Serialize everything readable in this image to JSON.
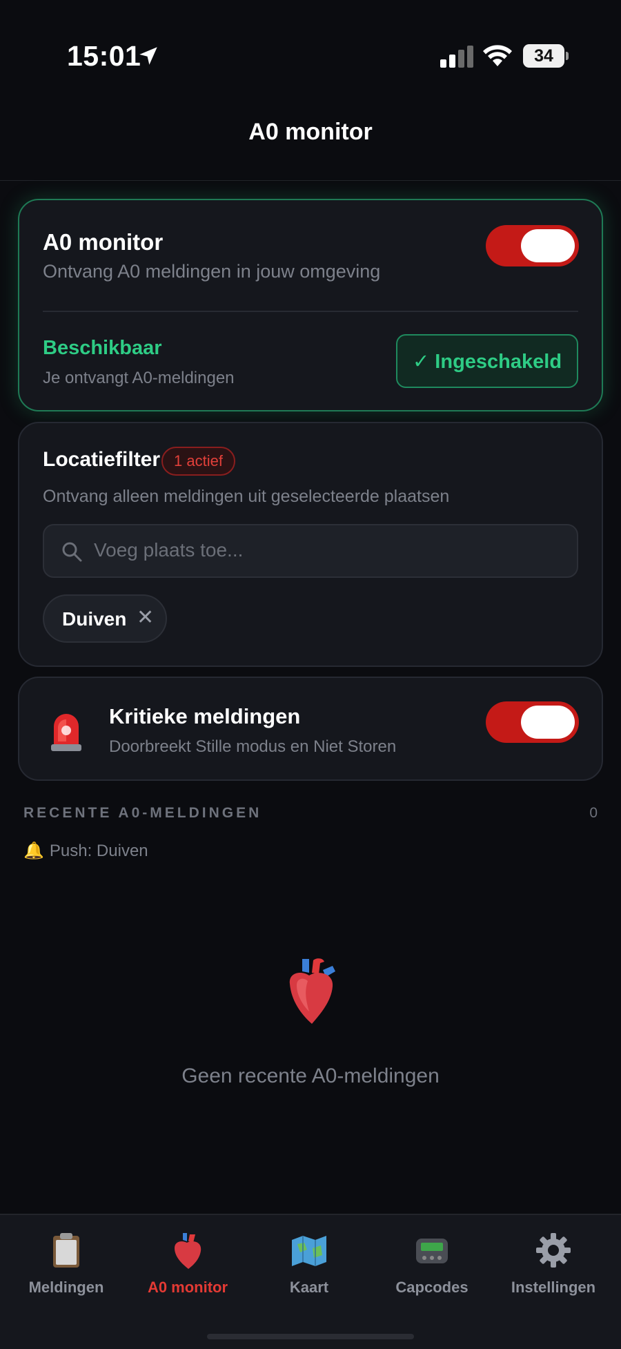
{
  "status_bar": {
    "time": "15:01",
    "battery": "34"
  },
  "header": {
    "title": "A0 monitor"
  },
  "monitor_card": {
    "title": "A0 monitor",
    "subtitle": "Ontvang A0 meldingen in jouw omgeving",
    "toggle_on": true,
    "availability_label": "Beschikbaar",
    "availability_sub": "Je ontvangt A0-meldingen",
    "enabled_button": "✓ Ingeschakeld"
  },
  "filter_card": {
    "title": "Locatiefilter",
    "badge": "1 actief",
    "subtitle": "Ontvang alleen meldingen uit geselecteerde plaatsen",
    "search_placeholder": "Voeg plaats toe...",
    "chips": [
      {
        "label": "Duiven",
        "remove": "✕"
      }
    ]
  },
  "critical_card": {
    "title": "Kritieke meldingen",
    "subtitle": "Doorbreekt Stille modus en Niet Storen",
    "toggle_on": true
  },
  "recent": {
    "section_title": "RECENTE A0-MELDINGEN",
    "count": "0",
    "push_info": "Push: Duiven",
    "empty_text": "Geen recente A0-meldingen"
  },
  "tabs": [
    {
      "label": "Meldingen",
      "icon": "clipboard-icon",
      "active": false
    },
    {
      "label": "A0 monitor",
      "icon": "heart-icon",
      "active": true
    },
    {
      "label": "Kaart",
      "icon": "map-icon",
      "active": false
    },
    {
      "label": "Capcodes",
      "icon": "pager-icon",
      "active": false
    },
    {
      "label": "Instellingen",
      "icon": "gear-icon",
      "active": false
    }
  ],
  "colors": {
    "accent_red": "#c41a17",
    "accent_green": "#2ecc85",
    "background": "#0b0c10",
    "card": "#15171d"
  }
}
